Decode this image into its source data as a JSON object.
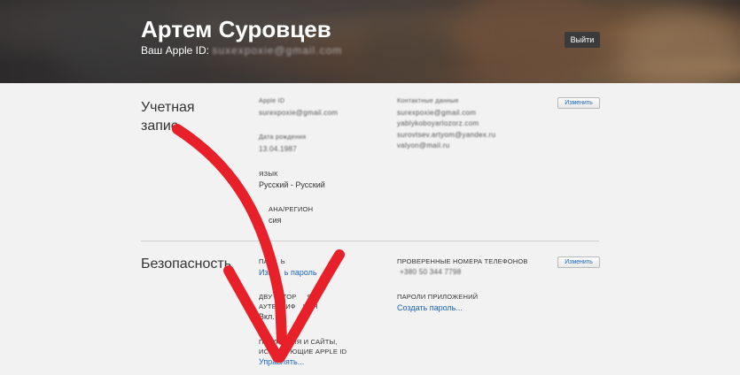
{
  "header": {
    "name": "Артем Суровцев",
    "apple_id_label": "Ваш Apple ID:",
    "apple_id_value": "suxexpoxie@gmail.com",
    "logout_label": "Выйти"
  },
  "account": {
    "title_line1": "Учетная",
    "title_line2": "запис",
    "apple_id_label": "Apple ID",
    "apple_id_value": "surexpoxie@gmail.com",
    "birthday_label": "Дата рождения",
    "birthday_value": "13.04.1987",
    "language_label": "Язык",
    "language_value": "Русский - Русский",
    "country_label": "ана/регион",
    "country_value": "сия",
    "contacts_label": "Контактные данные",
    "contacts": [
      "surexpoxie@gmail.com",
      "yablykoboyarlozorz.com",
      "surovtsev.artyom@yandex.ru",
      "valyon@mail.ru"
    ],
    "edit_label": "Изменить"
  },
  "security": {
    "title": "Безопасность",
    "password_label": "Па",
    "password_label_end": "ь",
    "change_password_link": "Изм",
    "change_password_link_end": "ь пароль",
    "twofactor_label_line1": "Дву",
    "twofactor_label_line1_end": "ктор",
    "twofactor_label_line1_tail": "я",
    "twofactor_label_line2": "аутентиф",
    "twofactor_label_line2_end": "ция",
    "twofactor_value": "Вкл.",
    "apps_label_line1": "Прил",
    "apps_label_line1_end": "ния и сайты,",
    "apps_label_line2": "испо",
    "apps_label_line2_end": "ующие Apple ID",
    "apps_link": "Управлять...",
    "phones_label": "Проверенные номера телефонов",
    "phones_value": "+380 50 344 7798",
    "app_passwords_label": "Пароли приложений",
    "app_passwords_link": "Создать пароль...",
    "edit_label": "Изменить"
  },
  "colors": {
    "arrow": "#e8202a",
    "link": "#1a65c0"
  }
}
